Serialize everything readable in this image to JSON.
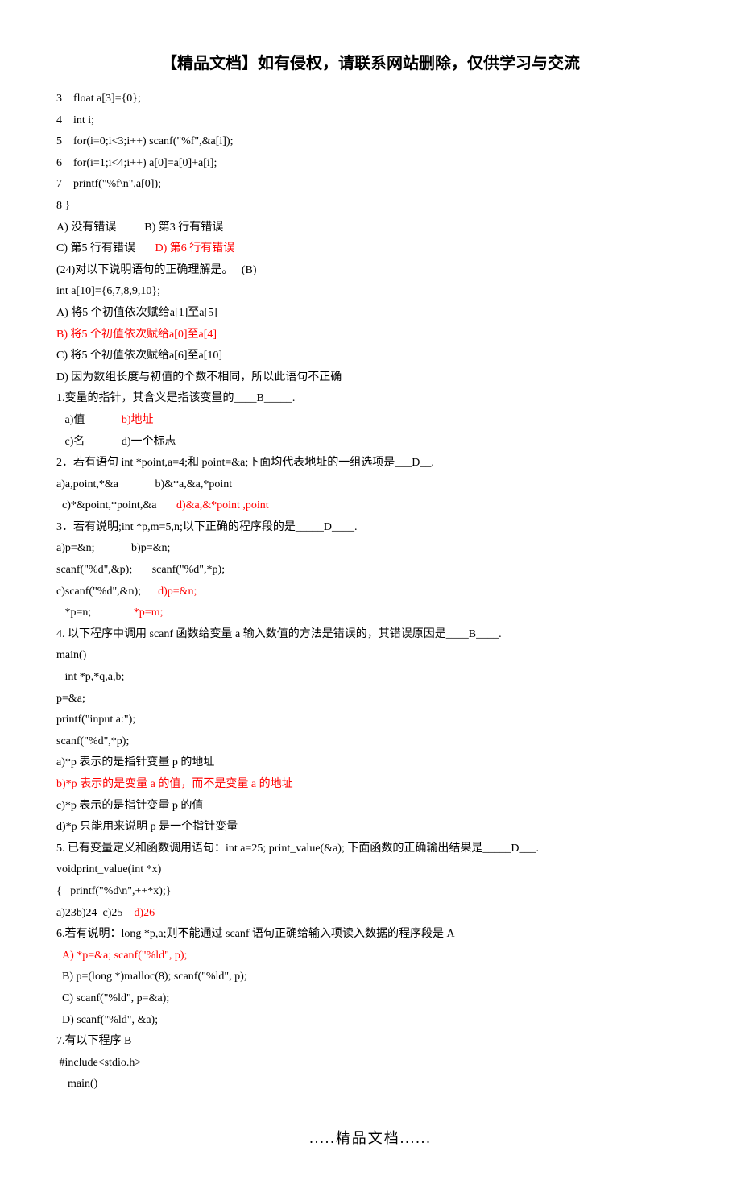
{
  "title": "【精品文档】如有侵权，请联系网站删除，仅供学习与交流",
  "lines": [
    {
      "t": "3    float a[3]={0};"
    },
    {
      "t": "4    int i;"
    },
    {
      "t": "5    for(i=0;i<3;i++) scanf(\"%f\",&a[i]);"
    },
    {
      "t": "6    for(i=1;i<4;i++) a[0]=a[0]+a[i];"
    },
    {
      "t": "7    printf(\"%f\\n\",a[0]);"
    },
    {
      "t": "8 }"
    },
    {
      "t": "A) 没有错误          B) 第3 行有错误"
    },
    {
      "parts": [
        {
          "t": "C) 第5 行有错误       "
        },
        {
          "t": "D) 第6 行有错误",
          "red": true
        }
      ]
    },
    {
      "t": "(24)对以下说明语句的正确理解是。   (B)"
    },
    {
      "t": "int a[10]={6,7,8,9,10};"
    },
    {
      "t": "A) 将5 个初值依次赋给a[1]至a[5]"
    },
    {
      "t": "B) 将5 个初值依次赋给a[0]至a[4]",
      "red": true
    },
    {
      "t": "C) 将5 个初值依次赋给a[6]至a[10]"
    },
    {
      "t": "D) 因为数组长度与初值的个数不相同，所以此语句不正确"
    },
    {
      "t": "1.变量的指针，其含义是指该变量的____B_____."
    },
    {
      "parts": [
        {
          "t": "   a)值             "
        },
        {
          "t": "b)地址",
          "red": true
        }
      ]
    },
    {
      "t": "   c)名             d)一个标志"
    },
    {
      "t": "2．若有语句 int *point,a=4;和 point=&a;下面均代表地址的一组选项是___D__."
    },
    {
      "t": "a)a,point,*&a             b)&*a,&a,*point"
    },
    {
      "parts": [
        {
          "t": "  c)*&point,*point,&a       "
        },
        {
          "t": "d)&a,&*point ,point",
          "red": true
        }
      ]
    },
    {
      "t": "3．若有说明;int *p,m=5,n;以下正确的程序段的是_____D____."
    },
    {
      "t": "a)p=&n;             b)p=&n;"
    },
    {
      "t": "scanf(\"%d\",&p);       scanf(\"%d\",*p);"
    },
    {
      "parts": [
        {
          "t": "c)scanf(\"%d\",&n);      "
        },
        {
          "t": "d)p=&n;",
          "red": true
        }
      ]
    },
    {
      "parts": [
        {
          "t": "   *p=n;               "
        },
        {
          "t": "*p=m;",
          "red": true
        }
      ]
    },
    {
      "t": "4. 以下程序中调用 scanf 函数给变量 a 输入数值的方法是错误的，其错误原因是____B____."
    },
    {
      "t": "main()"
    },
    {
      "t": "   int *p,*q,a,b;"
    },
    {
      "t": "p=&a;"
    },
    {
      "t": "printf(\"input a:\");"
    },
    {
      "t": "scanf(\"%d\",*p);"
    },
    {
      "t": "a)*p 表示的是指针变量 p 的地址"
    },
    {
      "t": "b)*p 表示的是变量 a 的值，而不是变量 a 的地址",
      "red": true
    },
    {
      "t": "c)*p 表示的是指针变量 p 的值"
    },
    {
      "t": "d)*p 只能用来说明 p 是一个指针变量"
    },
    {
      "t": "5. 已有变量定义和函数调用语句：int a=25; print_value(&a); 下面函数的正确输出结果是_____D___."
    },
    {
      "t": "voidprint_value(int *x)"
    },
    {
      "t": "{   printf(\"%d\\n\",++*x);}"
    },
    {
      "parts": [
        {
          "t": "a)23b)24  c)25    "
        },
        {
          "t": "d)26",
          "red": true
        }
      ]
    },
    {
      "t": "6.若有说明：long *p,a;则不能通过 scanf 语句正确给输入项读入数据的程序段是 A"
    },
    {
      "t": "  A) *p=&a; scanf(\"%ld\", p);",
      "red": true
    },
    {
      "t": "  B) p=(long *)malloc(8); scanf(\"%ld\", p);"
    },
    {
      "t": "  C) scanf(\"%ld\", p=&a);"
    },
    {
      "t": "  D) scanf(\"%ld\", &a);"
    },
    {
      "t": "7.有以下程序 B"
    },
    {
      "t": " #include<stdio.h>"
    },
    {
      "t": "    main()"
    }
  ],
  "footer": ".....精品文档......"
}
